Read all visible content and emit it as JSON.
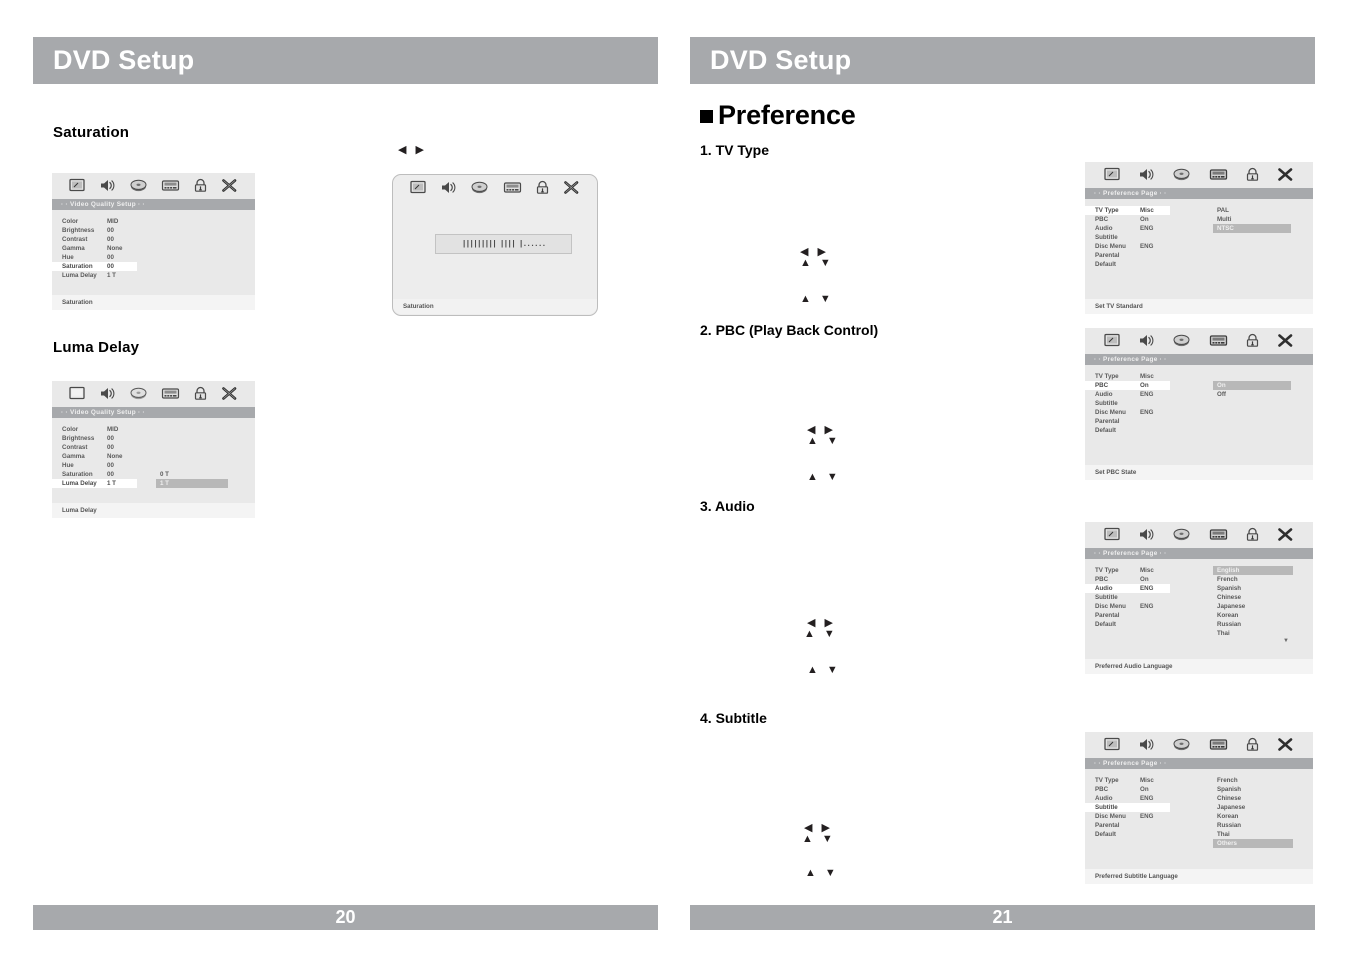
{
  "document": {
    "title": "DVD Setup"
  },
  "pages": [
    {
      "header": "DVD Setup",
      "footer": "20",
      "headings": {
        "saturation": "Saturation",
        "luma_delay": "Luma Delay"
      },
      "osd_saturation": {
        "title": "· · Video Quality Setup · ·",
        "status": "Saturation",
        "rows": [
          {
            "label": "Color",
            "value": "MID",
            "selected": false
          },
          {
            "label": "Brightness",
            "value": "00",
            "selected": false
          },
          {
            "label": "Contrast",
            "value": "00",
            "selected": false
          },
          {
            "label": "Gamma",
            "value": "None",
            "selected": false
          },
          {
            "label": "Hue",
            "value": "00",
            "selected": false
          },
          {
            "label": "Saturation",
            "value": "00",
            "selected": true
          },
          {
            "label": "Luma Delay",
            "value": "1 T",
            "selected": false
          }
        ]
      },
      "osd_slider": {
        "status": "Saturation",
        "ticks": "||||||||| |||| |......"
      },
      "osd_luma": {
        "title": "· · Video Quality Setup · ·",
        "status": "Luma Delay",
        "rows": [
          {
            "label": "Color",
            "value": "MID",
            "selected": false
          },
          {
            "label": "Brightness",
            "value": "00",
            "selected": false
          },
          {
            "label": "Contrast",
            "value": "00",
            "selected": false
          },
          {
            "label": "Gamma",
            "value": "None",
            "selected": false
          },
          {
            "label": "Hue",
            "value": "00",
            "selected": false
          },
          {
            "label": "Saturation",
            "value": "00",
            "selected": false
          },
          {
            "label": "Luma Delay",
            "value": "1 T",
            "selected": true
          }
        ],
        "submenu": [
          {
            "label": "0 T",
            "selected": false
          },
          {
            "label": "1 T",
            "selected": true
          }
        ]
      },
      "arrows_lr": [
        "◀",
        "▶"
      ]
    },
    {
      "header": "DVD Setup",
      "footer": "21",
      "section_title": "Preference",
      "items": [
        {
          "num": "1. TV Type"
        },
        {
          "num": "2. PBC (Play Back Control)"
        },
        {
          "num": "3. Audio"
        },
        {
          "num": "4. Subtitle"
        }
      ],
      "osd_common_rows": [
        {
          "label": "TV Type",
          "value": "Misc"
        },
        {
          "label": "PBC",
          "value": "On"
        },
        {
          "label": "Audio",
          "value": "ENG"
        },
        {
          "label": "Subtitle",
          "value": ""
        },
        {
          "label": "Disc Menu",
          "value": "ENG"
        },
        {
          "label": "Parental",
          "value": ""
        },
        {
          "label": "Default",
          "value": ""
        }
      ],
      "osd_tv_type": {
        "title": "· · Preference Page · ·",
        "status": "Set TV Standard",
        "selected_row": 0,
        "submenu": [
          {
            "label": "PAL",
            "selected": false
          },
          {
            "label": "Multi",
            "selected": false
          },
          {
            "label": "NTSC",
            "selected": true
          }
        ]
      },
      "osd_pbc": {
        "title": "· · Preference Page · ·",
        "status": "Set PBC State",
        "selected_row": 1,
        "submenu": [
          {
            "label": "On",
            "selected": true
          },
          {
            "label": "Off",
            "selected": false
          }
        ]
      },
      "osd_audio": {
        "title": "· · Preference Page · ·",
        "status": "Preferred Audio Language",
        "selected_row": 2,
        "submenu": [
          {
            "label": "English",
            "selected": true
          },
          {
            "label": "French",
            "selected": false
          },
          {
            "label": "Spanish",
            "selected": false
          },
          {
            "label": "Chinese",
            "selected": false
          },
          {
            "label": "Japanese",
            "selected": false
          },
          {
            "label": "Korean",
            "selected": false
          },
          {
            "label": "Russian",
            "selected": false
          },
          {
            "label": "Thai",
            "selected": false
          }
        ],
        "more": "▼"
      },
      "osd_subtitle": {
        "title": "· · Preference Page · ·",
        "status": "Preferred Subtitle Language",
        "selected_row": 3,
        "submenu": [
          {
            "label": "French",
            "selected": false
          },
          {
            "label": "Spanish",
            "selected": false
          },
          {
            "label": "Chinese",
            "selected": false
          },
          {
            "label": "Japanese",
            "selected": false
          },
          {
            "label": "Korean",
            "selected": false
          },
          {
            "label": "Russian",
            "selected": false
          },
          {
            "label": "Thai",
            "selected": false
          },
          {
            "label": "Others",
            "selected": true
          }
        ]
      },
      "arrow_groups": {
        "lr": [
          "◀",
          "▶"
        ],
        "ud": [
          "▲",
          "▼"
        ]
      }
    }
  ],
  "icons": [
    "tv-icon",
    "speaker-icon",
    "disc-icon",
    "preference-icon",
    "lock-icon",
    "exit-icon"
  ],
  "colors": {
    "bar_gray": "#a7a9ac",
    "osd_bg": "#e9e9e9",
    "osd_highlight": "#b8b8b8",
    "osd_selected": "#ffffff"
  }
}
